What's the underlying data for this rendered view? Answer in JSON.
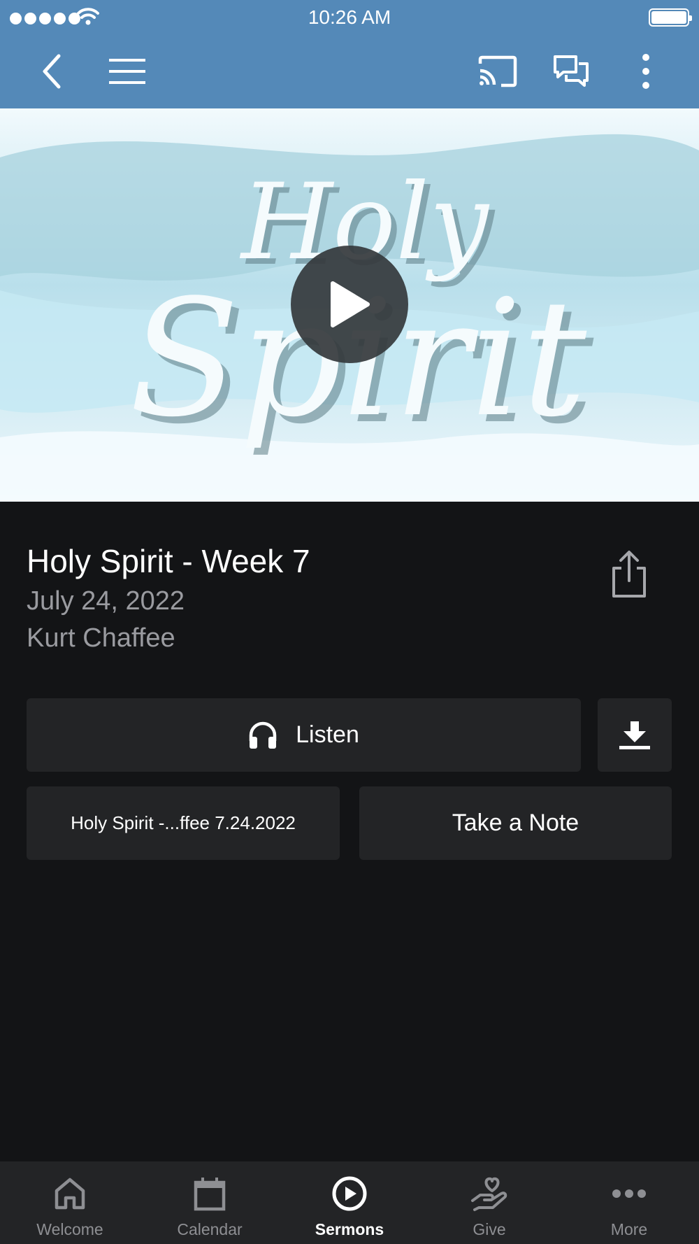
{
  "status_bar": {
    "time": "10:26 AM"
  },
  "app_bar": {
    "icons": [
      "back-icon",
      "menu-icon",
      "cast-icon",
      "chat-icon",
      "more-vert-icon"
    ]
  },
  "hero": {
    "art_line1": "Holy",
    "art_line2": "Spirit"
  },
  "sermon": {
    "title": "Holy Spirit - Week 7",
    "date": "July 24, 2022",
    "speaker": "Kurt Chaffee"
  },
  "actions": {
    "listen_label": "Listen",
    "file_label": "Holy Spirit -...ffee 7.24.2022",
    "note_label": "Take a Note"
  },
  "nav": {
    "items": [
      {
        "label": "Welcome",
        "icon": "home-icon"
      },
      {
        "label": "Calendar",
        "icon": "calendar-icon"
      },
      {
        "label": "Sermons",
        "icon": "play-circle-icon",
        "active": true
      },
      {
        "label": "Give",
        "icon": "give-icon"
      },
      {
        "label": "More",
        "icon": "more-horiz-icon"
      }
    ]
  },
  "colors": {
    "app_bar": "#5489b8",
    "background": "#131416",
    "button": "#232426",
    "muted_text": "#9a9ba0"
  }
}
